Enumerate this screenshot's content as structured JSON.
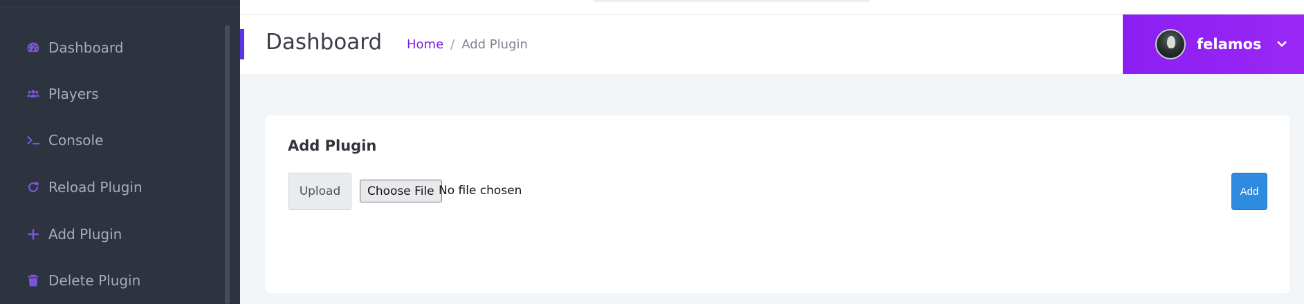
{
  "sidebar": {
    "items": [
      {
        "label": "Dashboard",
        "icon": "tachometer-icon"
      },
      {
        "label": "Players",
        "icon": "users-icon"
      },
      {
        "label": "Console",
        "icon": "terminal-icon"
      },
      {
        "label": "Reload Plugin",
        "icon": "redo-icon"
      },
      {
        "label": "Add Plugin",
        "icon": "plus-icon"
      },
      {
        "label": "Delete Plugin",
        "icon": "trash-icon"
      }
    ]
  },
  "header": {
    "title": "Dashboard",
    "breadcrumb": {
      "home": "Home",
      "separator": "/",
      "current": "Add Plugin"
    },
    "user": {
      "name": "felamos"
    }
  },
  "card": {
    "title": "Add Plugin",
    "upload_label": "Upload",
    "file_button": "Choose File",
    "file_status": "No file chosen",
    "submit_label": "Add"
  },
  "colors": {
    "sidebar_bg": "#2e3340",
    "accent_purple": "#8b1ff2",
    "breadcrumb_link": "#7b1fe0",
    "add_button": "#2f8bdf"
  }
}
